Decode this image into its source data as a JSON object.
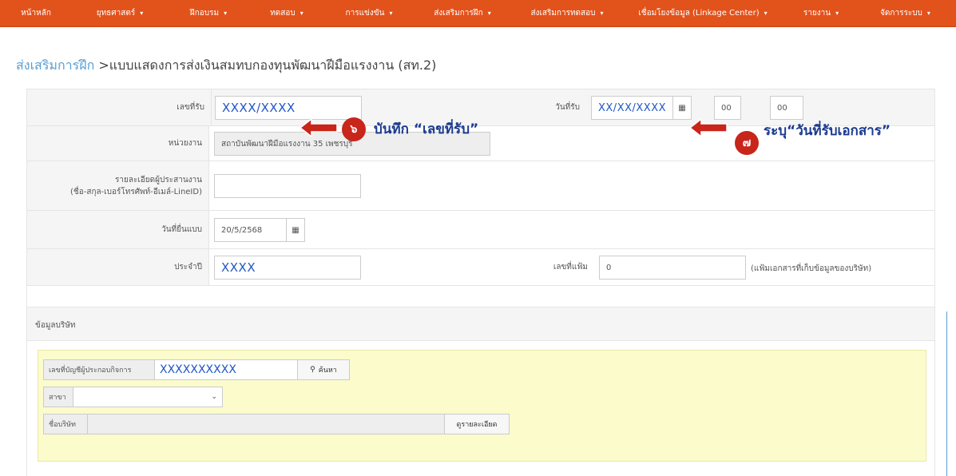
{
  "navbar": {
    "items": [
      {
        "label": "หน้าหลัก",
        "has_caret": false
      },
      {
        "label": "ยุทธศาสตร์",
        "has_caret": true
      },
      {
        "label": "ฝึกอบรม",
        "has_caret": true
      },
      {
        "label": "ทดสอบ",
        "has_caret": true
      },
      {
        "label": "การแข่งขัน",
        "has_caret": true
      },
      {
        "label": "ส่งเสริมการฝึก",
        "has_caret": true
      },
      {
        "label": "ส่งเสริมการทดสอบ",
        "has_caret": true
      },
      {
        "label": "เชื่อมโยงข้อมูล (Linkage Center)",
        "has_caret": true
      },
      {
        "label": "รายงาน",
        "has_caret": true
      },
      {
        "label": "จัดการระบบ",
        "has_caret": true
      }
    ],
    "caret": "▾",
    "color": "#e2521b"
  },
  "title": {
    "crumb": "ส่งเสริมการฝึก",
    "separator": " >",
    "text": "แบบแสดงการส่งเงินสมทบกองทุนพัฒนาฝีมือแรงงาน (สท.2)"
  },
  "form": {
    "receipt_no": {
      "label": "เลขที่รับ",
      "value": "XXXX/XXXX"
    },
    "receipt_date": {
      "label": "วันที่รับ",
      "value": "XX/XX/XXXX",
      "hour": "00",
      "minute": "00"
    },
    "agency": {
      "label": "หน่วยงาน",
      "value": "สถาบันพัฒนาฝีมือแรงงาน 35 เพชรบุรี"
    },
    "coordinator": {
      "label_line1": "รายละเอียดผู้ประสานงาน",
      "label_line2": "(ชื่อ-สกุล-เบอร์โทรศัพท์-อีเมล์-LineID)",
      "value": ""
    },
    "submit_date": {
      "label": "วันที่ยื่นแบบ",
      "value": "20/5/2568"
    },
    "year": {
      "label": "ประจำปี",
      "value": "XXXX"
    },
    "file_no": {
      "label": "เลขที่แฟ้ม",
      "value": "0",
      "hint": "(แฟ้มเอกสารที่เก็บข้อมูลของบริษัท)"
    }
  },
  "annotations": {
    "step6": {
      "badge": "๖",
      "text": "บันทึก “เลขที่รับ”"
    },
    "step7": {
      "badge": "๗",
      "text": "ระบุ“วันที่รับเอกสาร”"
    },
    "color": "#c8251b"
  },
  "company": {
    "header": "ข้อมูลบริษัท",
    "account_label": "เลขที่บัญชีผู้ประกอบกิจการ",
    "account_value": "XXXXXXXXXX",
    "search_button": "ค้นหา",
    "branch_label": "สาขา",
    "branch_value": "",
    "name_label": "ชื่อบริษัท",
    "name_value": "",
    "detail_button": "ดูรายละเอียด"
  },
  "icons": {
    "calendar": "calendar-icon",
    "search": "search-icon"
  }
}
